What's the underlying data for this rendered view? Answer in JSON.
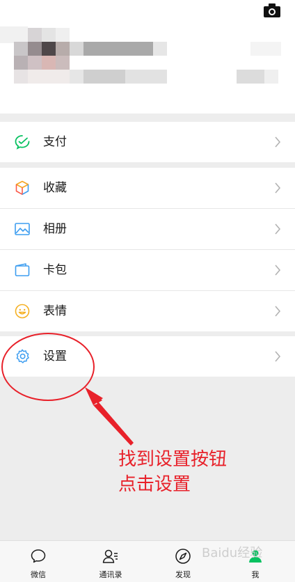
{
  "profile": {
    "camera_icon": "camera-icon"
  },
  "menu": {
    "pay": "支付",
    "favorites": "收藏",
    "album": "相册",
    "cards": "卡包",
    "stickers": "表情",
    "settings": "设置"
  },
  "annotation": {
    "line1": "找到设置按钮",
    "line2": "点击设置",
    "color": "#e8212a"
  },
  "tabbar": {
    "chats": "微信",
    "contacts": "通讯录",
    "discover": "发现",
    "me": "我"
  },
  "watermark": "Baidu经验",
  "colors": {
    "accent": "#07c160",
    "background": "#ededed"
  }
}
